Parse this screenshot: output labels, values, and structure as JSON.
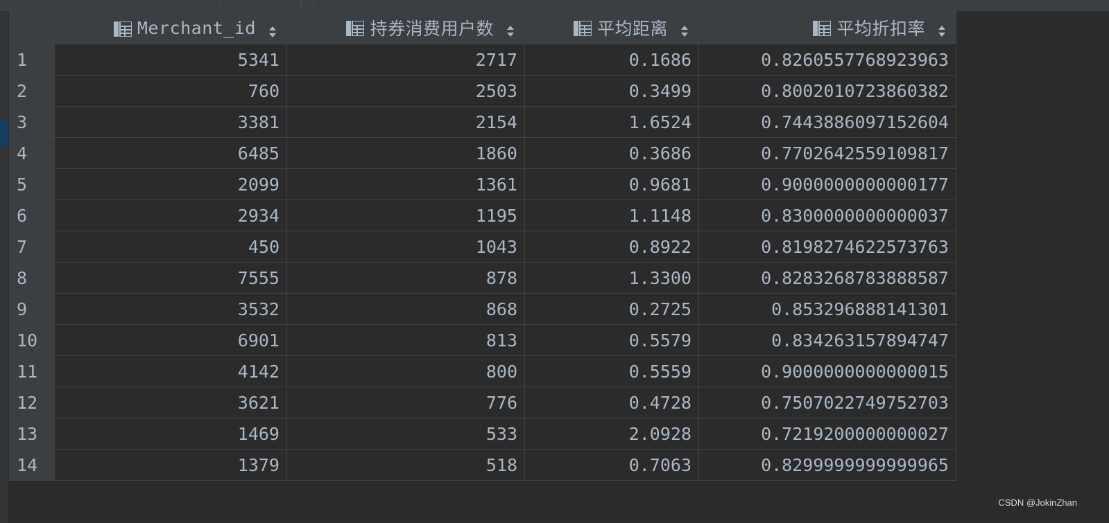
{
  "table": {
    "columns": [
      {
        "key": "merchant_id",
        "label": "Merchant_id",
        "icon": "column-icon",
        "sort_icon": "sort-icon"
      },
      {
        "key": "users",
        "label": "持券消费用户数",
        "icon": "column-icon",
        "sort_icon": "sort-icon"
      },
      {
        "key": "avg_distance",
        "label": "平均距离",
        "icon": "column-icon",
        "sort_icon": "sort-icon"
      },
      {
        "key": "avg_discount",
        "label": "平均折扣率",
        "icon": "column-icon",
        "sort_icon": "sort-icon"
      }
    ],
    "rows": [
      {
        "n": "1",
        "merchant_id": "5341",
        "users": "2717",
        "avg_distance": "0.1686",
        "avg_discount": "0.8260557768923963"
      },
      {
        "n": "2",
        "merchant_id": "760",
        "users": "2503",
        "avg_distance": "0.3499",
        "avg_discount": "0.8002010723860382"
      },
      {
        "n": "3",
        "merchant_id": "3381",
        "users": "2154",
        "avg_distance": "1.6524",
        "avg_discount": "0.7443886097152604"
      },
      {
        "n": "4",
        "merchant_id": "6485",
        "users": "1860",
        "avg_distance": "0.3686",
        "avg_discount": "0.7702642559109817"
      },
      {
        "n": "5",
        "merchant_id": "2099",
        "users": "1361",
        "avg_distance": "0.9681",
        "avg_discount": "0.9000000000000177"
      },
      {
        "n": "6",
        "merchant_id": "2934",
        "users": "1195",
        "avg_distance": "1.1148",
        "avg_discount": "0.8300000000000037"
      },
      {
        "n": "7",
        "merchant_id": "450",
        "users": "1043",
        "avg_distance": "0.8922",
        "avg_discount": "0.8198274622573763"
      },
      {
        "n": "8",
        "merchant_id": "7555",
        "users": "878",
        "avg_distance": "1.3300",
        "avg_discount": "0.8283268783888587"
      },
      {
        "n": "9",
        "merchant_id": "3532",
        "users": "868",
        "avg_distance": "0.2725",
        "avg_discount": "0.853296888141301"
      },
      {
        "n": "10",
        "merchant_id": "6901",
        "users": "813",
        "avg_distance": "0.5579",
        "avg_discount": "0.834263157894747"
      },
      {
        "n": "11",
        "merchant_id": "4142",
        "users": "800",
        "avg_distance": "0.5559",
        "avg_discount": "0.9000000000000015"
      },
      {
        "n": "12",
        "merchant_id": "3621",
        "users": "776",
        "avg_distance": "0.4728",
        "avg_discount": "0.7507022749752703"
      },
      {
        "n": "13",
        "merchant_id": "1469",
        "users": "533",
        "avg_distance": "2.0928",
        "avg_discount": "0.7219200000000027"
      },
      {
        "n": "14",
        "merchant_id": "1379",
        "users": "518",
        "avg_distance": "0.7063",
        "avg_discount": "0.8299999999999965"
      }
    ]
  },
  "watermark": "CSDN @JokinZhan",
  "colors": {
    "background": "#2b2b2b",
    "header_bg": "#3c3f41",
    "text": "#a9b7c6",
    "grid_line": "#3f4244",
    "gutter_marker": "#173d5e"
  }
}
